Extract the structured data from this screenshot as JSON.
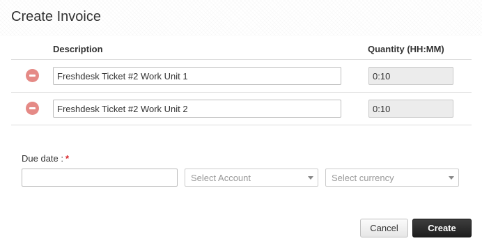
{
  "dialog": {
    "title": "Create Invoice"
  },
  "table": {
    "headers": {
      "description": "Description",
      "quantity": "Quantity (HH:MM)"
    },
    "rows": [
      {
        "description": "Freshdesk Ticket #2 Work Unit 1",
        "quantity": "0:10"
      },
      {
        "description": "Freshdesk Ticket #2 Work Unit 2",
        "quantity": "0:10"
      }
    ]
  },
  "form": {
    "due_date_label": "Due date :",
    "required_mark": "*",
    "due_date_value": "",
    "account_select": {
      "placeholder": "Select Account"
    },
    "currency_select": {
      "placeholder": "Select currency"
    }
  },
  "buttons": {
    "cancel": "Cancel",
    "create": "Create"
  },
  "colors": {
    "remove_icon": "#e58a86",
    "required": "#d9262b",
    "primary_button": "#2b2b2b"
  },
  "icons": {
    "remove": "minus-circle-icon",
    "dropdown": "caret-down-icon"
  }
}
